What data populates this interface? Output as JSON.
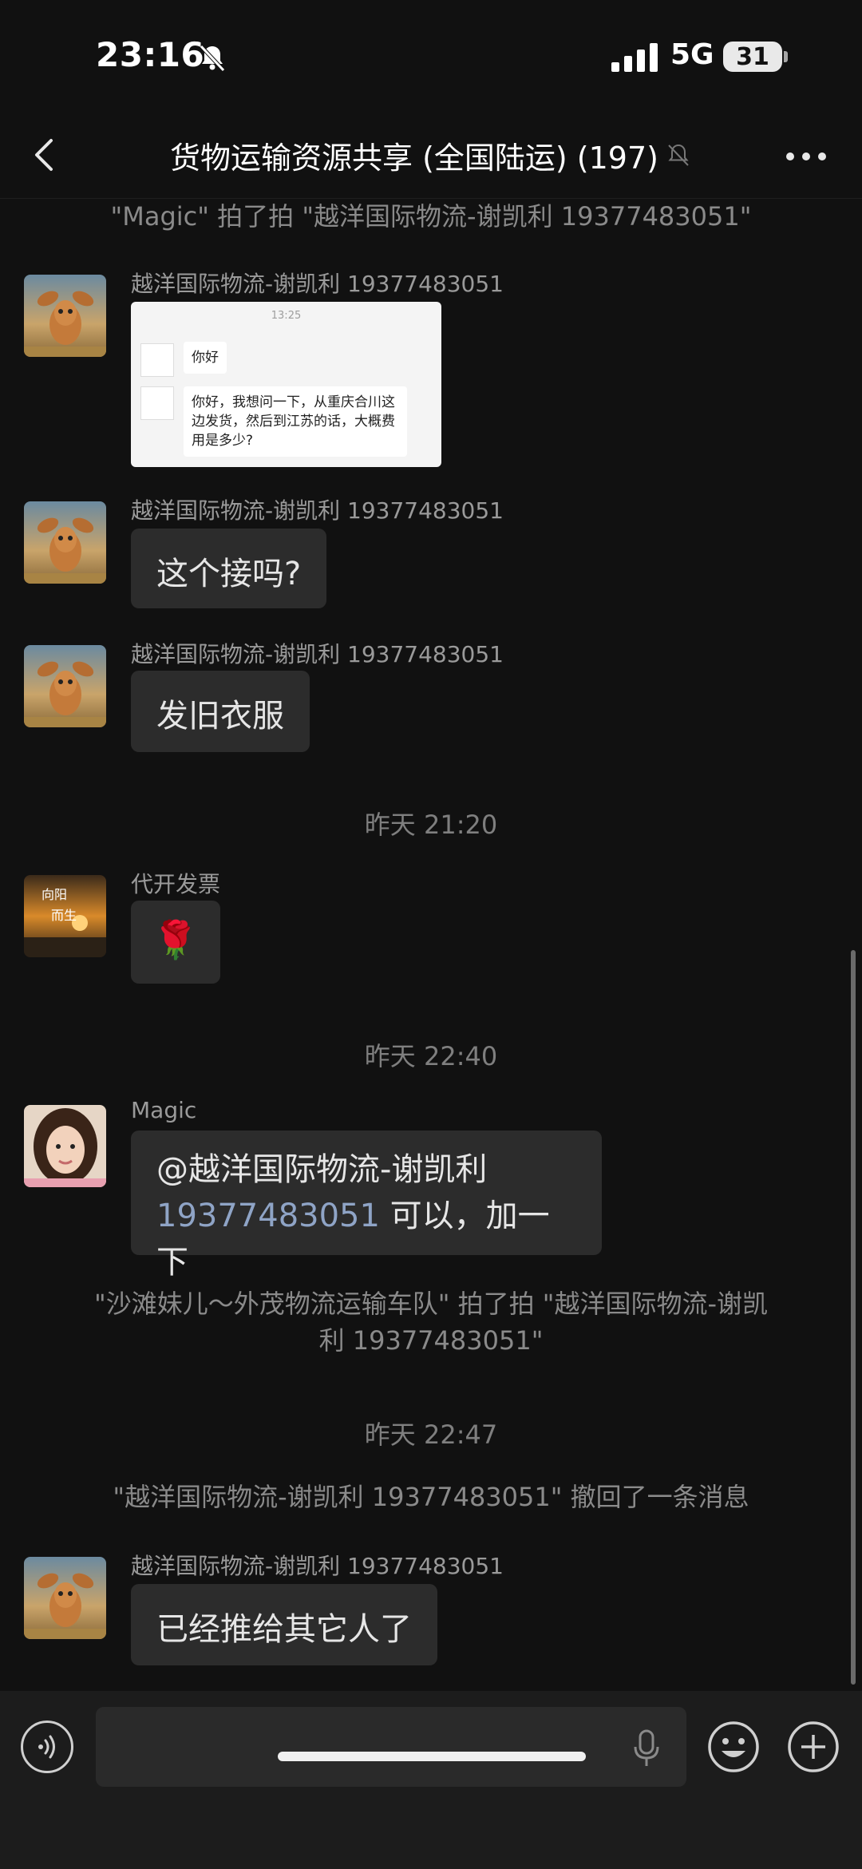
{
  "status_bar": {
    "time": "23:16",
    "network": "5G",
    "battery": "31"
  },
  "header": {
    "title": "货物运输资源共享 (全国陆运) (197)"
  },
  "messages": {
    "sys_pat_1": "\"Magic\" 拍了拍 \"越洋国际物流-谢凯利 19377483051\"",
    "m1_sender": "越洋国际物流-谢凯利 19377483051",
    "m1_image": {
      "time": "13:25",
      "line1": "你好",
      "line2": "你好，我想问一下，从重庆合川这边发货，然后到江苏的话，大概费用是多少?"
    },
    "m2_sender": "越洋国际物流-谢凯利 19377483051",
    "m2_text": "这个接吗?",
    "m3_sender": "越洋国际物流-谢凯利 19377483051",
    "m3_text": "发旧衣服",
    "time_1": "昨天 21:20",
    "m4_sender": "代开发票",
    "m4_avatar_text": "向阳而生",
    "m4_emoji": "🌹",
    "time_2": "昨天 22:40",
    "m5_sender": "Magic",
    "m5_line1": "@越洋国际物流-谢凯利",
    "m5_phone": "19377483051",
    "m5_rest": " 可以，加一下",
    "sys_pat_2_line1": "\"沙滩妹儿～外茂物流运输车队\" 拍了拍 \"越洋国际物流-谢凯",
    "sys_pat_2_line2": "利 19377483051\"",
    "time_3": "昨天 22:47",
    "sys_recall": "\"越洋国际物流-谢凯利 19377483051\" 撤回了一条消息",
    "m6_sender": "越洋国际物流-谢凯利 19377483051",
    "m6_text": "已经推给其它人了"
  },
  "colors": {
    "background": "#111111",
    "bubble": "#2c2c2c",
    "link": "#8fa4c6"
  }
}
